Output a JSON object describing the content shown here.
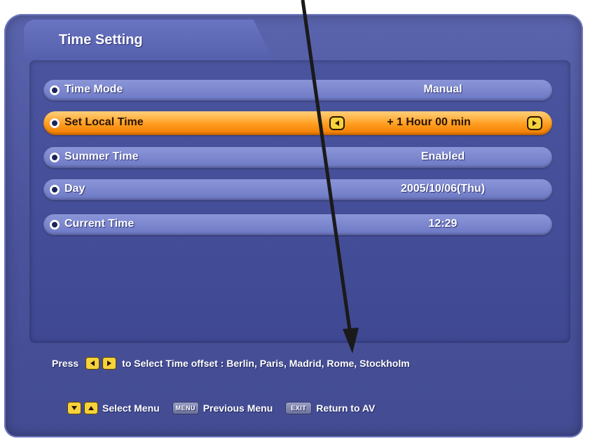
{
  "menu": {
    "title": "Time Setting",
    "rows": [
      {
        "label": "Time Mode",
        "value": "Manual"
      },
      {
        "label": "Set Local Time",
        "value": "+ 1 Hour 00 min"
      },
      {
        "label": "Summer Time",
        "value": "Enabled"
      },
      {
        "label": "Day",
        "value": "2005/10/06(Thu)"
      },
      {
        "label": "Current Time",
        "value": "12:29"
      }
    ],
    "selected_index": 1
  },
  "help": {
    "press": "Press",
    "text": "to Select Time offset : Berlin, Paris, Madrid, Rome, Stockholm"
  },
  "footer": {
    "select_menu": "Select Menu",
    "menu_key": "MENU",
    "previous_menu": "Previous Menu",
    "exit_key": "EXIT",
    "return_av": "Return to AV"
  },
  "colors": {
    "panel": "#4a539c",
    "row": "#7b85cc",
    "selected_row": "#ff9c1e",
    "key_yellow": "#f6d23c",
    "pointer_arrow": "#1a1a1a"
  },
  "icons": {
    "row_bullet": "radio-bullet-icon",
    "left_arrow": "left-arrow-icon",
    "right_arrow": "right-arrow-icon",
    "down_arrow": "down-arrow-icon",
    "up_arrow": "up-arrow-icon",
    "pointer": "annotation-arrow-icon"
  }
}
